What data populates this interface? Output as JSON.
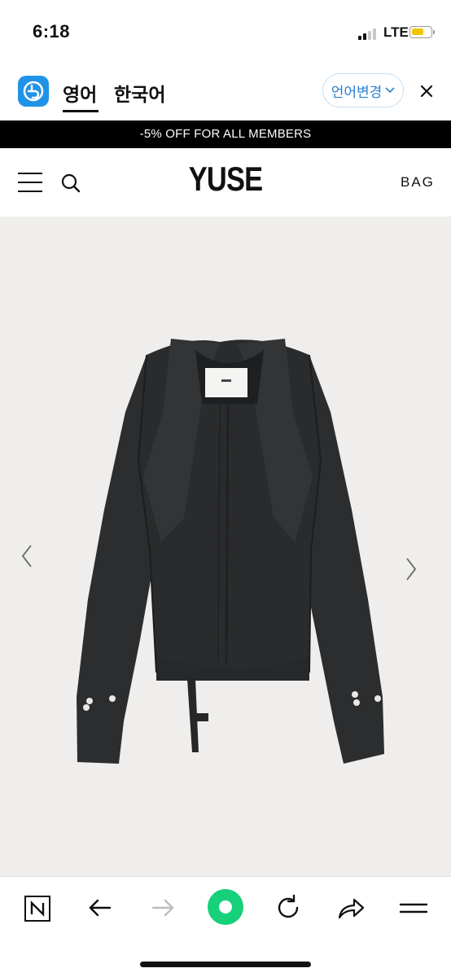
{
  "status_bar": {
    "time": "6:18",
    "network": "LTE"
  },
  "translate_bar": {
    "tabs": [
      {
        "label": "영어",
        "active": true
      },
      {
        "label": "한국어",
        "active": false
      }
    ],
    "change_language": "언어변경",
    "close_icon": "close-icon"
  },
  "promo": {
    "text": "-5% OFF FOR ALL MEMBERS"
  },
  "header": {
    "brand": "YUSE",
    "bag": "BAG"
  },
  "product": {
    "image_description_icon": "jacket-image",
    "prev_icon": "chevron-left-icon",
    "next_icon": "chevron-right-icon"
  },
  "toolbar": {
    "icons": [
      "naver-icon",
      "back-arrow-icon",
      "forward-arrow-icon",
      "green-dot-icon",
      "refresh-icon",
      "share-icon",
      "menu-icon"
    ]
  },
  "colors": {
    "accent_blue": "#2a7fd0",
    "papago_blue": "#1f93e8",
    "green_button": "#17d07a",
    "promo_bg": "#000000",
    "product_bg": "#efeeec"
  }
}
